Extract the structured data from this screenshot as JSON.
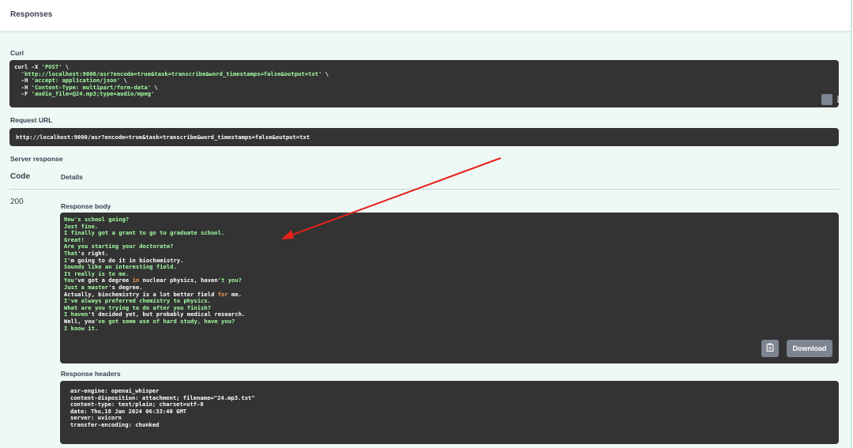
{
  "responses": {
    "title": "Responses"
  },
  "curl": {
    "label": "Curl",
    "lines": [
      {
        "pre": "curl -X ",
        "str": "'POST'",
        "post": " \\"
      },
      {
        "pre": "  ",
        "str": "'http://localhost:9000/asr?encode=true&task=transcribe&word_timestamps=false&output=txt'",
        "post": " \\"
      },
      {
        "pre": "  -H ",
        "str": "'accept: application/json'",
        "post": " \\"
      },
      {
        "pre": "  -H ",
        "str": "'Content-Type: multipart/form-data'",
        "post": " \\"
      },
      {
        "pre": "  -F ",
        "str": "'audio_file=@24.mp3;type=audio/mpeg'",
        "post": ""
      }
    ],
    "copy_icon": "clipboard-icon"
  },
  "request_url": {
    "label": "Request URL",
    "value": "http://localhost:9000/asr?encode=true&task=transcribe&word_timestamps=false&output=txt"
  },
  "server_response": {
    "label": "Server response",
    "col_code": "Code",
    "col_details": "Details",
    "code": "200",
    "response_body_label": "Response body",
    "body_lines": [
      [
        {
          "c": "k",
          "t": "How's school going?"
        }
      ],
      [
        {
          "c": "k",
          "t": "Just fine."
        }
      ],
      [
        {
          "c": "k",
          "t": "I finally got a grant to go to graduate school."
        }
      ],
      [
        {
          "c": "k",
          "t": "Great!"
        }
      ],
      [
        {
          "c": "k",
          "t": "Are you starting your doctorate?"
        }
      ],
      [
        {
          "c": "k",
          "t": "That"
        },
        {
          "c": "w",
          "t": "'s right."
        }
      ],
      [
        {
          "c": "k",
          "t": "I"
        },
        {
          "c": "w",
          "t": "'m going to do it in biochemistry."
        }
      ],
      [
        {
          "c": "k",
          "t": "Sounds like an interesting field."
        }
      ],
      [
        {
          "c": "k",
          "t": "It really is to me."
        }
      ],
      [
        {
          "c": "k",
          "t": "You"
        },
        {
          "c": "w",
          "t": "'ve got a degree "
        },
        {
          "c": "o",
          "t": "in"
        },
        {
          "c": "w",
          "t": " nuclear physics, haven"
        },
        {
          "c": "k",
          "t": "'t you?"
        }
      ],
      [
        {
          "c": "k",
          "t": "Just a master"
        },
        {
          "c": "w",
          "t": "'s degree."
        }
      ],
      [
        {
          "c": "w",
          "t": "Actually, biochemistry is a lot better field "
        },
        {
          "c": "o",
          "t": "for"
        },
        {
          "c": "w",
          "t": " me."
        }
      ],
      [
        {
          "c": "k",
          "t": "I've always preferred chemistry to physics."
        }
      ],
      [
        {
          "c": "k",
          "t": "What are you trying to do after you finish?"
        }
      ],
      [
        {
          "c": "k",
          "t": "I haven"
        },
        {
          "c": "w",
          "t": "'t decided yet, but probably medical research."
        }
      ],
      [
        {
          "c": "w",
          "t": "Well, you"
        },
        {
          "c": "k",
          "t": "'ve got some use of hard study, have you?"
        }
      ],
      [
        {
          "c": "k",
          "t": "I know it."
        }
      ]
    ],
    "download_label": "Download",
    "copy_icon": "clipboard-icon",
    "response_headers_label": "Response headers",
    "headers": [
      "asr-engine: openai_whisper",
      "content-disposition: attachment; filename=\"24.mp3.txt\"",
      "content-type: text/plain; charset=utf-8",
      "date: Thu,18 Jan 2024 06:33:40 GMT",
      "server: uvicorn",
      "transfer-encoding: chunked"
    ]
  },
  "annotation": {
    "arrow_color": "#e8211a"
  }
}
